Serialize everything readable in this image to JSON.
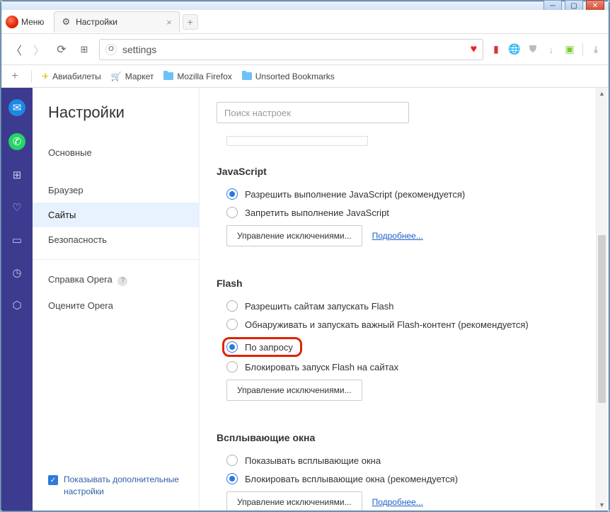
{
  "window": {
    "menu_label": "Меню",
    "tab": {
      "title": "Настройки"
    },
    "address": "settings"
  },
  "bookmarks": [
    {
      "icon": "plane",
      "label": "Авиабилеты"
    },
    {
      "icon": "cart",
      "label": "Маркет"
    },
    {
      "icon": "folder",
      "label": "Mozilla Firefox"
    },
    {
      "icon": "folder",
      "label": "Unsorted Bookmarks"
    }
  ],
  "sidebar": {
    "title": "Настройки",
    "items": [
      {
        "label": "Основные"
      },
      {
        "label": "Браузер"
      },
      {
        "label": "Сайты"
      },
      {
        "label": "Безопасность"
      }
    ],
    "links": [
      {
        "label": "Справка Opera"
      },
      {
        "label": "Оцените Opera"
      }
    ],
    "advanced_checkbox": "Показывать дополнительные настройки"
  },
  "main": {
    "search_placeholder": "Поиск настроек",
    "sections": {
      "javascript": {
        "title": "JavaScript",
        "options": [
          "Разрешить выполнение JavaScript (рекомендуется)",
          "Запретить выполнение JavaScript"
        ],
        "manage_btn": "Управление исключениями...",
        "more_link": "Подробнее..."
      },
      "flash": {
        "title": "Flash",
        "options": [
          "Разрешить сайтам запускать Flash",
          "Обнаруживать и запускать важный Flash-контент (рекомендуется)",
          "По запросу",
          "Блокировать запуск Flash на сайтах"
        ],
        "manage_btn": "Управление исключениями..."
      },
      "popups": {
        "title": "Всплывающие окна",
        "options": [
          "Показывать всплывающие окна",
          "Блокировать всплывающие окна (рекомендуется)"
        ],
        "manage_btn": "Управление исключениями...",
        "more_link": "Подробнее..."
      }
    }
  }
}
